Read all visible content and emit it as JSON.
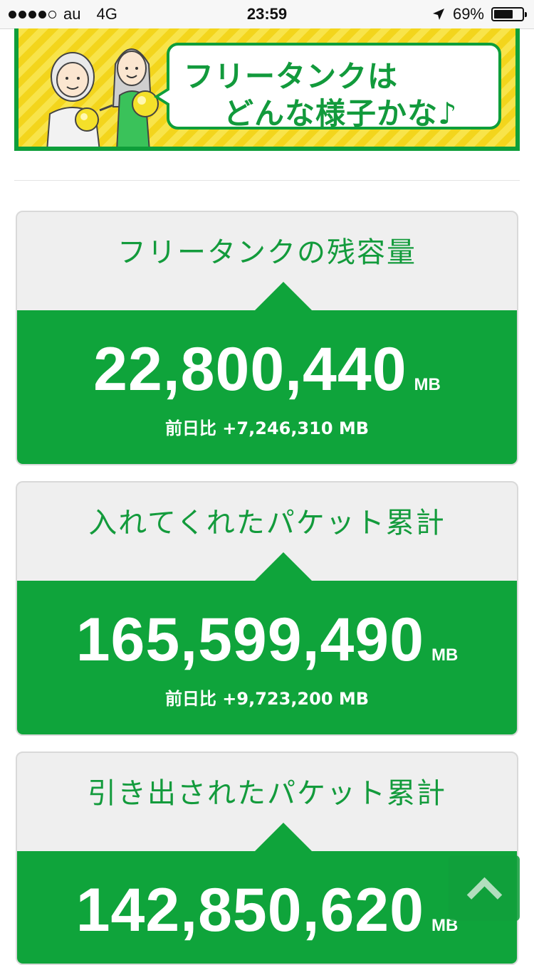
{
  "status_bar": {
    "carrier": "au",
    "network": "4G",
    "time": "23:59",
    "battery_percent": "69%",
    "battery_level": 0.69
  },
  "banner": {
    "line1": "フリータンクは",
    "line2": "どんな様子かな♪"
  },
  "cards": [
    {
      "title": "フリータンクの残容量",
      "value": "22,800,440",
      "unit": "MB",
      "diff": "前日比 +7,246,310 MB"
    },
    {
      "title": "入れてくれたパケット累計",
      "value": "165,599,490",
      "unit": "MB",
      "diff": "前日比 +9,723,200 MB"
    },
    {
      "title": "引き出されたパケット累計",
      "value": "142,850,620",
      "unit": "MB",
      "diff": ""
    }
  ],
  "colors": {
    "brand_green": "#0fa43b",
    "banner_yellow": "#f6dc23",
    "title_green": "#139b3c"
  },
  "icons": {
    "location": "location-arrow-icon",
    "scroll_top": "chevron-up-icon"
  }
}
